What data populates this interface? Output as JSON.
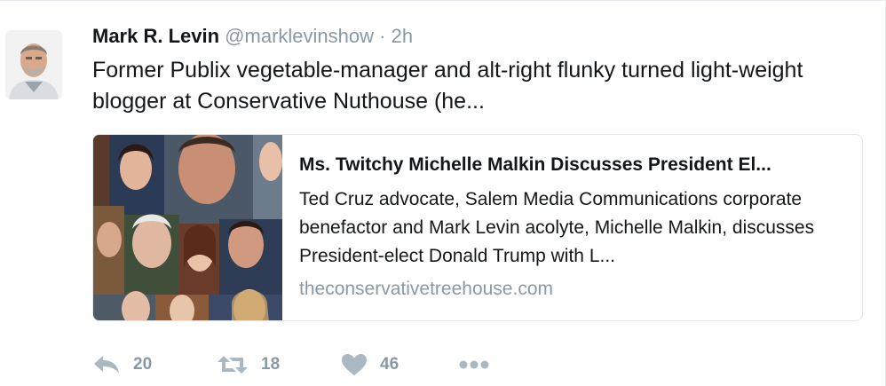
{
  "tweet": {
    "author_name": "Mark R. Levin",
    "author_handle": "@marklevinshow",
    "separator": "·",
    "time": "2h",
    "text": "Former Publix vegetable-manager and alt-right flunky turned light-weight blogger at Conservative Nuthouse (he..."
  },
  "card": {
    "title": "Ms. Twitchy Michelle Malkin Discusses President El...",
    "description": "Ted Cruz advocate, Salem Media Communications corporate benefactor and Mark Levin acolyte, Michelle Malkin, discusses President-elect Donald Trump with L...",
    "domain": "theconservativetreehouse.com"
  },
  "actions": {
    "reply_count": "20",
    "retweet_count": "18",
    "like_count": "46"
  },
  "icons": {
    "reply": "reply-icon",
    "retweet": "retweet-icon",
    "like": "heart-icon",
    "more": "more-dots-icon"
  },
  "colors": {
    "text": "#14171a",
    "muted": "#8899a6",
    "icon": "#aab8c2",
    "border": "#e1e8ed"
  }
}
